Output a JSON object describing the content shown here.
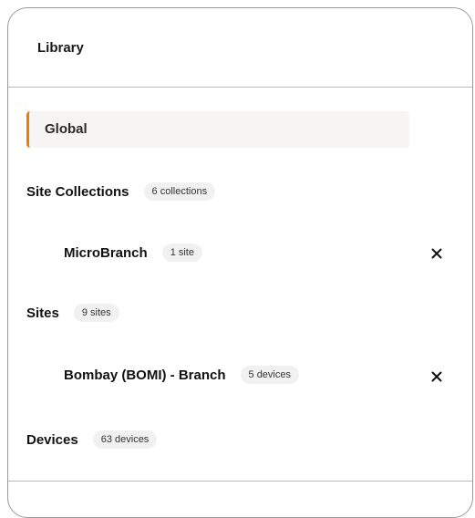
{
  "panel": {
    "title": "Library"
  },
  "global": {
    "label": "Global"
  },
  "site_collections": {
    "label": "Site Collections",
    "count_badge": "6 collections",
    "items": [
      {
        "label": "MicroBranch",
        "count_badge": "1 site",
        "remove_icon": "close-icon"
      }
    ]
  },
  "sites": {
    "label": "Sites",
    "count_badge": "9 sites",
    "items": [
      {
        "label": "Bombay (BOMI) - Branch",
        "count_badge": "5 devices",
        "remove_icon": "close-icon"
      }
    ]
  },
  "devices": {
    "label": "Devices",
    "count_badge": "63 devices"
  },
  "colors": {
    "accent": "#f07d00",
    "selected_bg": "#f7f5f3",
    "badge_bg": "#f1f1f1",
    "border": "#9a9a9a"
  }
}
